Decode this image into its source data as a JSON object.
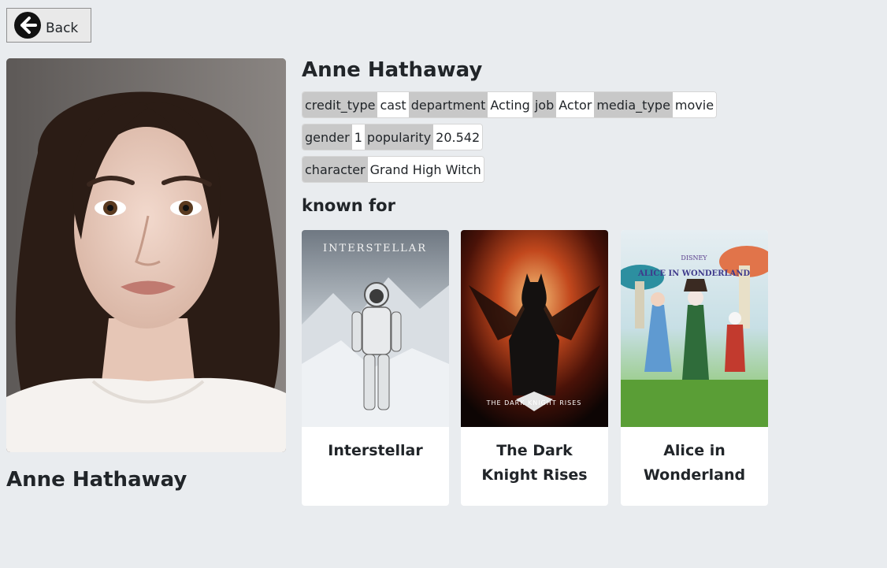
{
  "back_button": {
    "label": "Back"
  },
  "person": {
    "name": "Anne Hathaway",
    "photo_alt": "Anne Hathaway portrait"
  },
  "tags": [
    [
      {
        "key": "credit_type",
        "value": "cast"
      },
      {
        "key": "department",
        "value": "Acting"
      },
      {
        "key": "job",
        "value": "Actor"
      },
      {
        "key": "media_type",
        "value": "movie"
      }
    ],
    [
      {
        "key": "gender",
        "value": "1"
      },
      {
        "key": "popularity",
        "value": "20.542"
      }
    ],
    [
      {
        "key": "character",
        "value": "Grand High Witch"
      }
    ]
  ],
  "known_for": {
    "heading": "known for",
    "movies": [
      {
        "title": "Interstellar",
        "poster_text": "INTERSTELLAR"
      },
      {
        "title": "The Dark Knight Rises",
        "poster_text": "THE DARK KNIGHT RISES"
      },
      {
        "title": "Alice in Wonderland",
        "poster_text": "ALICE IN WONDERLAND",
        "poster_brand": "DISNEY"
      }
    ]
  }
}
